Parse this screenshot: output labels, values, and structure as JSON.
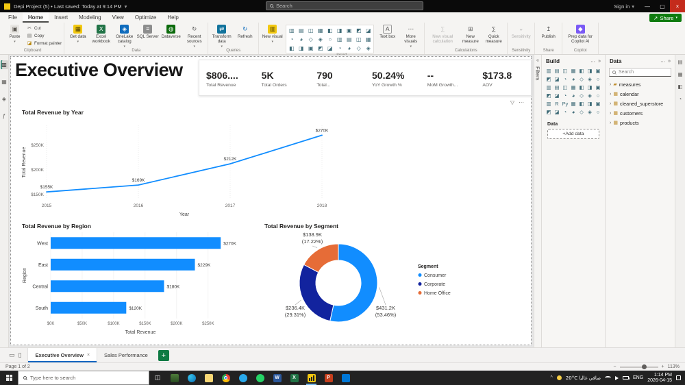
{
  "titlebar": {
    "app_title": "Depi Project (5) • Last saved: Today at 9:14 PM",
    "search_placeholder": "Search",
    "sign_in_label": "Sign in"
  },
  "ribbon": {
    "tabs": [
      "File",
      "Home",
      "Insert",
      "Modeling",
      "View",
      "Optimize",
      "Help"
    ],
    "active_tab": "Home",
    "share_label": "Share",
    "groups": [
      {
        "label": "Clipboard",
        "buttons": [
          {
            "name": "paste",
            "label": "Paste",
            "menu": true
          },
          {
            "name": "cut",
            "label": "Cut",
            "size": "small"
          },
          {
            "name": "copy",
            "label": "Copy",
            "size": "small"
          },
          {
            "name": "format-painter",
            "label": "Format painter",
            "size": "small"
          }
        ]
      },
      {
        "label": "Data",
        "buttons": [
          {
            "name": "get-data",
            "label": "Get data",
            "menu": true
          },
          {
            "name": "excel-workbook",
            "label": "Excel workbook"
          },
          {
            "name": "onelake-catalog",
            "label": "OneLake catalog",
            "menu": true
          },
          {
            "name": "sql-server",
            "label": "SQL Server"
          },
          {
            "name": "dataverse",
            "label": "Dataverse"
          },
          {
            "name": "recent-sources",
            "label": "Recent sources",
            "menu": true
          }
        ]
      },
      {
        "label": "Queries",
        "buttons": [
          {
            "name": "transform-data",
            "label": "Transform data",
            "menu": true
          },
          {
            "name": "refresh",
            "label": "Refresh"
          }
        ]
      },
      {
        "label": "Insert",
        "buttons": [
          {
            "name": "new-visual",
            "label": "New visual",
            "menu": true
          },
          {
            "name": "visual-gallery",
            "type": "grid"
          },
          {
            "name": "text-box",
            "label": "Text box"
          },
          {
            "name": "more-visuals",
            "label": "More visuals",
            "menu": true
          }
        ]
      },
      {
        "label": "Calculations",
        "buttons": [
          {
            "name": "new-visual-calculation",
            "label": "New visual calculation",
            "wide": true,
            "disabled": true
          },
          {
            "name": "new-measure",
            "label": "New measure"
          },
          {
            "name": "quick-measure",
            "label": "Quick measure"
          }
        ]
      },
      {
        "label": "Sensitivity",
        "buttons": [
          {
            "name": "sensitivity",
            "label": "Sensitivity",
            "disabled": true
          }
        ]
      },
      {
        "label": "Share",
        "buttons": [
          {
            "name": "publish",
            "label": "Publish"
          }
        ]
      },
      {
        "label": "Copilot",
        "buttons": [
          {
            "name": "prep-data-copilot",
            "label": "Prep data for Copilot AI",
            "wide": true
          }
        ]
      }
    ]
  },
  "visual_types": [
    "stacked-bar-chart",
    "stacked-column-chart",
    "clustered-bar-chart",
    "clustered-column-chart",
    "100-stacked-bar-chart",
    "100-stacked-column-chart",
    "line-chart",
    "area-chart",
    "stacked-area-chart",
    "line-and-stacked-column-chart",
    "line-and-clustered-column-chart",
    "ribbon-chart",
    "waterfall-chart",
    "funnel-chart",
    "scatter-chart",
    "pie-chart",
    "donut-chart",
    "treemap",
    "map",
    "filled-map",
    "shape-map",
    "azure-map",
    "gauge",
    "card",
    "multi-row-card",
    "kpi",
    "slicer",
    "table",
    "matrix",
    "r-script",
    "python-script",
    "key-influencers",
    "decomposition-tree",
    "qa",
    "smart-narrative",
    "paginated-report",
    "arcgis-map",
    "power-apps",
    "power-automate",
    "metrics",
    "button-slicer",
    "text-slicer"
  ],
  "report": {
    "title": "Executive Overview"
  },
  "kpis": [
    {
      "value": "$806....",
      "label": "Total Revenue"
    },
    {
      "value": "5K",
      "label": "Total Orders"
    },
    {
      "value": "790",
      "label": "Total..."
    },
    {
      "value": "50.24%",
      "label": "YoY Growth %"
    },
    {
      "value": "--",
      "label": "MoM Growth..."
    },
    {
      "value": "$173.8",
      "label": "AOV"
    }
  ],
  "chart_data": [
    {
      "type": "line",
      "title": "Total Revenue by Year",
      "x": [
        2015,
        2016,
        2017,
        2018
      ],
      "values": [
        155,
        169,
        212,
        270
      ],
      "point_labels": [
        "$155K",
        "$169K",
        "$212K",
        "$270K"
      ],
      "y_ticks": [
        150,
        200,
        250
      ],
      "y_tick_labels": [
        "$150K",
        "$200K",
        "$250K"
      ],
      "ylim": [
        140,
        290
      ],
      "xlabel": "Year",
      "ylabel": "Total Revenue",
      "color": "#118DFF"
    },
    {
      "type": "bar",
      "orientation": "horizontal",
      "title": "Total Revenue by Region",
      "categories": [
        "West",
        "East",
        "Central",
        "South"
      ],
      "values": [
        270,
        229,
        180,
        120
      ],
      "bar_labels": [
        "$270K",
        "$229K",
        "$180K",
        "$120K"
      ],
      "x_ticks": [
        0,
        50,
        100,
        150,
        200,
        250
      ],
      "x_tick_labels": [
        "$0K",
        "$50K",
        "$100K",
        "$150K",
        "$200K",
        "$250K"
      ],
      "xlim": [
        0,
        285
      ],
      "xlabel": "Total Revenue",
      "ylabel": "Region",
      "color": "#118DFF"
    },
    {
      "type": "donut",
      "title": "Total Revenue by Segment",
      "legend_title": "Segment",
      "slices": [
        {
          "name": "Consumer",
          "value_label": "$431.2K",
          "pct_label": "(53.46%)",
          "pct": 53.46,
          "color": "#118DFF"
        },
        {
          "name": "Corporate",
          "value_label": "$236.4K",
          "pct_label": "(29.31%)",
          "pct": 29.31,
          "color": "#12239E"
        },
        {
          "name": "Home Office",
          "value_label": "$138.9K",
          "pct_label": "(17.22%)",
          "pct": 17.22,
          "color": "#E66C37"
        }
      ]
    }
  ],
  "panes": {
    "filters_collapsed_label": "Filters",
    "build": {
      "title": "Build",
      "data_section_label": "Data",
      "add_data_label": "+Add data"
    },
    "data": {
      "title": "Data",
      "search_placeholder": "Search",
      "fields": [
        {
          "name": "measures",
          "icon": "folder-icon"
        },
        {
          "name": "calendar",
          "icon": "table-icon"
        },
        {
          "name": "cleaned_superstore",
          "icon": "table-icon"
        },
        {
          "name": "customers",
          "icon": "table-icon"
        },
        {
          "name": "products",
          "icon": "table-icon"
        }
      ]
    },
    "view_rail": [
      {
        "name": "report-view",
        "active": true
      },
      {
        "name": "table-view",
        "active": false
      },
      {
        "name": "model-view",
        "active": false
      },
      {
        "name": "dax-query-view",
        "active": false
      }
    ],
    "right_rail": [
      "data-pane",
      "build-pane",
      "format-pane",
      "analytics-pane"
    ]
  },
  "footer": {
    "status_left": "Page 1 of 2",
    "zoom_label": "113%",
    "page_tabs": [
      {
        "label": "Executive Overview",
        "active": true
      },
      {
        "label": "Sales Performance",
        "active": false
      }
    ]
  },
  "taskbar": {
    "search_placeholder": "Type here to search",
    "apps": [
      {
        "name": "photos-app-icon",
        "color": "#3a6b35"
      },
      {
        "name": "edge-icon",
        "color": "#0c86c8",
        "shape": "circle"
      },
      {
        "name": "file-explorer-icon",
        "color": "#f8d775"
      },
      {
        "name": "chrome-icon",
        "color": "#4285f4",
        "shape": "circle"
      },
      {
        "name": "telegram-icon",
        "color": "#29a9eb",
        "shape": "circle"
      },
      {
        "name": "whatsapp-icon",
        "color": "#25d366",
        "shape": "circle"
      },
      {
        "name": "word-icon",
        "color": "#2b579a",
        "letter": "W"
      },
      {
        "name": "excel-icon",
        "color": "#217346",
        "letter": "X"
      },
      {
        "name": "power-bi-icon",
        "color": "#f2c811",
        "running": true
      },
      {
        "name": "powerpoint-icon",
        "color": "#c43e1c",
        "letter": "P"
      },
      {
        "name": "vscode-icon",
        "color": "#0078d7"
      }
    ],
    "tray": {
      "weather": "20°C صافي غالبا",
      "lang": "ENG",
      "time": "1:14 PM",
      "date": "2026-04-15"
    }
  }
}
